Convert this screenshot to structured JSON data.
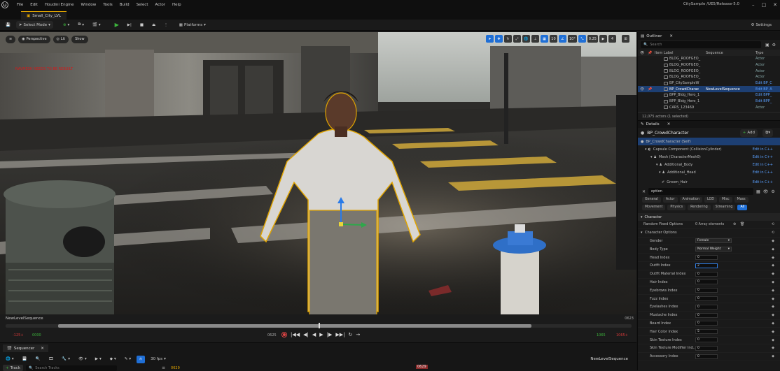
{
  "menubar": {
    "items": [
      "File",
      "Edit",
      "Houdini Engine",
      "Window",
      "Tools",
      "Build",
      "Select",
      "Actor",
      "Help"
    ],
    "project_title": "CitySample /UE5/Release-5.0"
  },
  "tab": {
    "label": "Small_City_LVL"
  },
  "toolbar": {
    "select_mode": "Select Mode",
    "platforms": "Platforms",
    "settings": "Settings"
  },
  "viewport": {
    "perspective": "Perspective",
    "lit": "Lit",
    "show": "Show",
    "warning_text": "NAVMESH NEEDS TO BE REBUILT",
    "grid_snap": "10",
    "rot_snap": "10°",
    "scale_snap": "0.25",
    "cam_speed": "4"
  },
  "sequence_strip": {
    "name": "NewLevelSequence",
    "frame_end": "0623",
    "start_red": "-125+",
    "start_green": "0000",
    "current_frame": "0625",
    "end_green": "1065",
    "end_red": "1065+",
    "progress": 0.5
  },
  "sequencer": {
    "tab_label": "Sequencer",
    "add_track": "Track",
    "search_placeholder": "Search Tracks",
    "fps": "30 fps",
    "frame_box": "0629",
    "timeline_frame": "0629",
    "sequence_name": "NewLevelSequence"
  },
  "outliner": {
    "title": "Outliner",
    "search_placeholder": "Search",
    "columns": {
      "label": "Item Label",
      "sequence": "Sequence",
      "type": "Type"
    },
    "rows": [
      {
        "name": "BLDG_ROOFGEO_",
        "seq": "",
        "type": "Actor",
        "link": false,
        "sel": false
      },
      {
        "name": "BLDG_ROOFGEO_",
        "seq": "",
        "type": "Actor",
        "link": false,
        "sel": false
      },
      {
        "name": "BLDG_ROOFGEO_",
        "seq": "",
        "type": "Actor",
        "link": false,
        "sel": false
      },
      {
        "name": "BLDG_ROOFGEO_",
        "seq": "",
        "type": "Actor",
        "link": false,
        "sel": false
      },
      {
        "name": "BP_CitySampleW",
        "seq": "",
        "type": "Edit BP_C",
        "link": true,
        "sel": false
      },
      {
        "name": "BP_CrowdCharac",
        "seq": "NewLevelSequence",
        "type": "Edit BP_A",
        "link": true,
        "sel": true
      },
      {
        "name": "BPP_Bldg_Hero_1",
        "seq": "",
        "type": "Edit BPP_",
        "link": true,
        "sel": false
      },
      {
        "name": "BPP_Bldg_Hero_1",
        "seq": "",
        "type": "Edit BPP_",
        "link": true,
        "sel": false
      },
      {
        "name": "CARS_123469",
        "seq": "",
        "type": "Actor",
        "link": false,
        "sel": false
      }
    ],
    "status": "12,075 actors (1 selected)"
  },
  "details": {
    "title": "Details",
    "actor_name": "BP_CrowdCharacter",
    "add_label": "Add",
    "components": [
      {
        "label": "BP_CrowdCharacter (Self)",
        "edit": "",
        "indent": 0,
        "sel": true
      },
      {
        "label": "Capsule Component (CollisionCylinder)",
        "edit": "Edit in C++",
        "indent": 1,
        "sel": false
      },
      {
        "label": "Mesh (CharacterMesh0)",
        "edit": "Edit in C++",
        "indent": 2,
        "sel": false
      },
      {
        "label": "Additional_Body",
        "edit": "Edit in C++",
        "indent": 3,
        "sel": false
      },
      {
        "label": "Additional_Head",
        "edit": "Edit in C++",
        "indent": 4,
        "sel": false
      },
      {
        "label": "Groom_Hair",
        "edit": "Edit in C++",
        "indent": 5,
        "sel": false
      }
    ],
    "filter_value": "option",
    "filter_tabs_row1": [
      "General",
      "Actor",
      "Animation",
      "LOD",
      "Misc",
      "Mass"
    ],
    "filter_tabs_row2": [
      "Movement",
      "Physics",
      "Rendering",
      "Streaming",
      "All"
    ],
    "section_character": "Character",
    "random_fixed_options": {
      "label": "Random Fixed Options",
      "value": "0 Array elements"
    },
    "character_options": "Character Options",
    "properties": [
      {
        "label": "Gender",
        "value": "Female",
        "dropdown": true,
        "sel": false
      },
      {
        "label": "Body Type",
        "value": "Normal Weight",
        "dropdown": true,
        "sel": false
      },
      {
        "label": "Head Index",
        "value": "0",
        "dropdown": false,
        "sel": false
      },
      {
        "label": "Outfit Index",
        "value": "2",
        "dropdown": false,
        "sel": true
      },
      {
        "label": "Outfit Material Index",
        "value": "0",
        "dropdown": false,
        "sel": false
      },
      {
        "label": "Hair Index",
        "value": "0",
        "dropdown": false,
        "sel": false
      },
      {
        "label": "Eyebrows Index",
        "value": "0",
        "dropdown": false,
        "sel": false
      },
      {
        "label": "Fuzz Index",
        "value": "0",
        "dropdown": false,
        "sel": false
      },
      {
        "label": "Eyelashes Index",
        "value": "0",
        "dropdown": false,
        "sel": false
      },
      {
        "label": "Mustache Index",
        "value": "0",
        "dropdown": false,
        "sel": false
      },
      {
        "label": "Beard Index",
        "value": "0",
        "dropdown": false,
        "sel": false
      },
      {
        "label": "Hair Color Index",
        "value": "5",
        "dropdown": false,
        "sel": false
      },
      {
        "label": "Skin Texture Index",
        "value": "0",
        "dropdown": false,
        "sel": false
      },
      {
        "label": "Skin Texture Modifier Ind..",
        "value": "0",
        "dropdown": false,
        "sel": false
      },
      {
        "label": "Accessory Index",
        "value": "0",
        "dropdown": false,
        "sel": false
      }
    ]
  },
  "colors": {
    "accent": "#1f6fd6",
    "selection": "#1d3f73",
    "outline": "#e0a400",
    "link": "#5aa0ff",
    "warning": "#d21b1b"
  }
}
